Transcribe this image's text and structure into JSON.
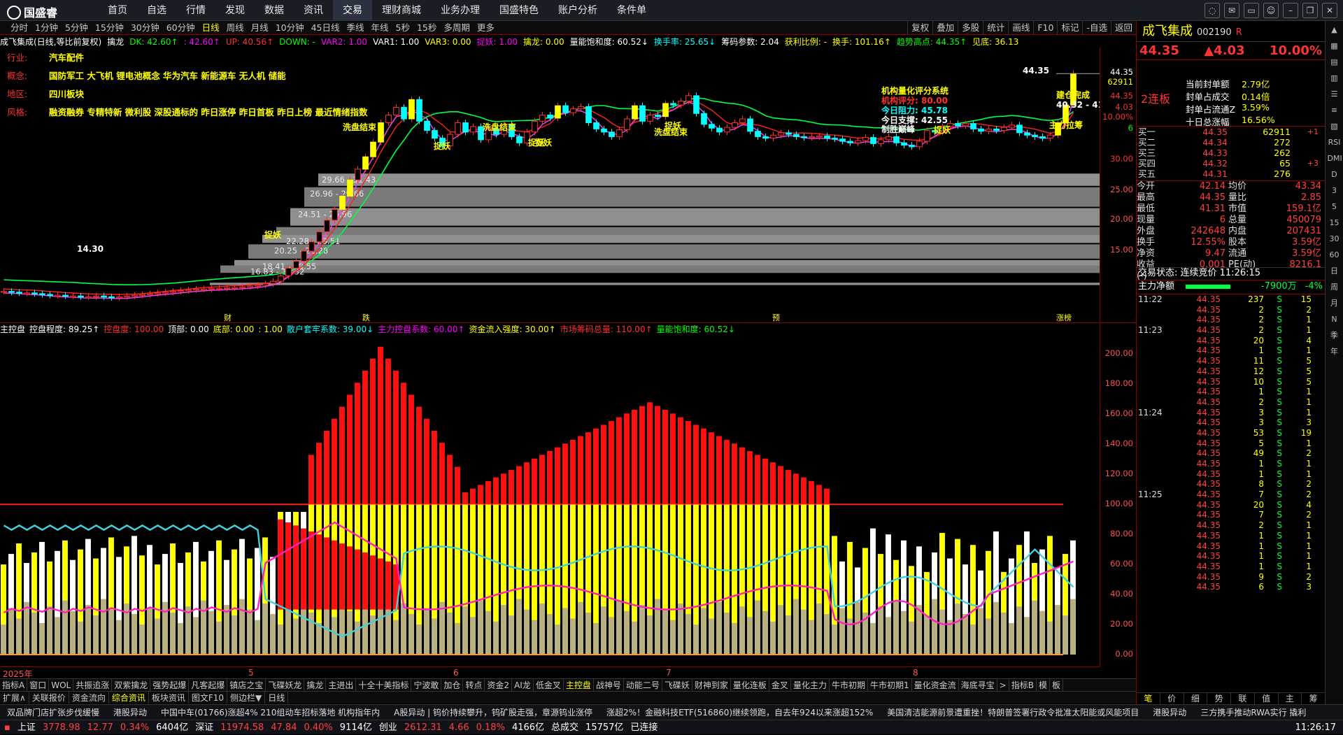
{
  "app": {
    "logo": "国盛睿"
  },
  "menu": [
    "首页",
    "自选",
    "行情",
    "发现",
    "数据",
    "资讯",
    "交易",
    "理财商城",
    "业务办理",
    "国盛特色",
    "账户分析",
    "条件单"
  ],
  "menu_active": 6,
  "window_icons": [
    "chat-icon",
    "mail-icon",
    "screen-icon",
    "user-icon",
    "minimize-icon",
    "restore-icon",
    "close-icon"
  ],
  "period": {
    "items": [
      "分时",
      "1分钟",
      "5分钟",
      "15分钟",
      "30分钟",
      "60分钟",
      "日线",
      "周线",
      "月线",
      "10分钟",
      "45日线",
      "季线",
      "年线",
      "5秒",
      "15秒",
      "多周期",
      "更多"
    ],
    "selected": 6,
    "tools": [
      "复权",
      "叠加",
      "多股",
      "统计",
      "画线",
      "F10",
      "标记",
      "-自选",
      "返回"
    ]
  },
  "quote_header": [
    {
      "t": "成飞集成(日线,等比前复权)",
      "c": "#ffffff"
    },
    {
      "t": "擒龙",
      "c": "#ffffff"
    },
    {
      "t": "DK: 42.60↑",
      "c": "#00ff00"
    },
    {
      "t": ": 42.60↑",
      "c": "#ff00ff"
    },
    {
      "t": "UP: 40.56↑",
      "c": "#ff3030"
    },
    {
      "t": "DOWN: -",
      "c": "#00ff00"
    },
    {
      "t": "VAR2: 1.00",
      "c": "#ff00ff"
    },
    {
      "t": "VAR1: 1.00",
      "c": "#ffffff"
    },
    {
      "t": "VAR3: 0.00",
      "c": "#ffff00"
    },
    {
      "t": "捉妖: 1.00",
      "c": "#ff00ff"
    },
    {
      "t": "擒龙: 0.00",
      "c": "#ffff00"
    },
    {
      "t": "量能饱和度: 60.52↓",
      "c": "#ffffff"
    },
    {
      "t": "换手率: 25.65↓",
      "c": "#00ffff"
    },
    {
      "t": "筹码参数: 2.04",
      "c": "#ffffff"
    },
    {
      "t": "获利比例: -",
      "c": "#ffff00"
    },
    {
      "t": "换手: 101.16↑",
      "c": "#ffff00"
    },
    {
      "t": "趋势高点: 44.35↑",
      "c": "#00ff00"
    },
    {
      "t": "见底: 36.13",
      "c": "#ffff00"
    }
  ],
  "info": [
    {
      "k": "行业:",
      "v": "汽车配件"
    },
    {
      "k": "概念:",
      "v": "国防军工 大飞机 锂电池概念 华为汽车 新能源车 无人机 储能"
    },
    {
      "k": "地区:",
      "v": "四川板块"
    },
    {
      "k": "风格:",
      "v": "融资融券 专精特新 微利股 深股通标的 昨日涨停 昨日首板 昨日上榜 最近情绪指数"
    }
  ],
  "k_annotations": [
    {
      "t": "洗盘结束",
      "c": "#ffff00"
    },
    {
      "t": "洗盘结束",
      "c": "#ffff00"
    },
    {
      "t": "洗盘结束",
      "c": "#ffff00"
    },
    {
      "t": "捉妖",
      "c": "#ffff00"
    },
    {
      "t": "捉妖",
      "c": "#ffff00"
    },
    {
      "t": "捉妖",
      "c": "#ffff00"
    },
    {
      "t": "捉妖",
      "c": "#ffff00"
    },
    {
      "t": "捉妖",
      "c": "#ffff00"
    },
    {
      "t": "机构量化评分系统",
      "c": "#ffff00"
    },
    {
      "t": "机构评分: 80.00",
      "c": "#ff3030"
    },
    {
      "t": "今日阻力: 45.78",
      "c": "#00ffff"
    },
    {
      "t": "今日支撑: 42.55",
      "c": "#ffffff"
    },
    {
      "t": "制胜巅峰",
      "c": "#ffffff"
    },
    {
      "t": "建仓完成",
      "c": "#ffff00"
    },
    {
      "t": "主力拉筹",
      "c": "#ffff00"
    },
    {
      "t": "44.35",
      "c": "#ffffff"
    },
    {
      "t": "14.30",
      "c": "#ffffff"
    },
    {
      "t": "40.32 - 41.3",
      "c": "#ffffff"
    }
  ],
  "chip_labels": [
    "29.66 - 31.43",
    "26.96 - 29.66",
    "24.51 - 26.96",
    "22.28 - 23.51",
    "20.25 - 22.28",
    "18.41 - 19.55",
    "16.83 - 17.32"
  ],
  "chip_tag": "捉妖",
  "price_axis": {
    "labels": [
      "44.35",
      "62911",
      "44.35",
      "4.03",
      "10.00%",
      "6",
      "30.00",
      "25.00",
      "20.00",
      "15.00"
    ]
  },
  "x_bottom_tags": [
    "财",
    "跌",
    "预",
    "涨榜"
  ],
  "ind_header": [
    {
      "t": "主控盘",
      "c": "#ffffff"
    },
    {
      "t": "控盘程度: 89.25↑",
      "c": "#ffffff"
    },
    {
      "t": "控盘度: 100.00",
      "c": "#ff3030"
    },
    {
      "t": "顶部: 0.00",
      "c": "#ffffff"
    },
    {
      "t": "底部: 0.00",
      "c": "#ffff00"
    },
    {
      "t": ": 1.00",
      "c": "#ffff00"
    },
    {
      "t": "散户套牢系数: 39.00↓",
      "c": "#00ffff"
    },
    {
      "t": "主力控盘系数: 60.00↑",
      "c": "#ff00ff"
    },
    {
      "t": "资金流入强度: 30.00↑",
      "c": "#ffff00"
    },
    {
      "t": "市场筹码总量: 110.00↑",
      "c": "#ff3030"
    },
    {
      "t": "量能饱和度: 60.52↓",
      "c": "#00ff00"
    }
  ],
  "ind_axis": [
    "200.00",
    "180.00",
    "160.00",
    "140.00",
    "120.00",
    "100.00",
    "80.00",
    "60.00",
    "40.00",
    "20.00",
    "0.00"
  ],
  "xaxis": [
    "2025年",
    "5",
    "6",
    "7",
    "8"
  ],
  "ind_tabs": [
    "指标A",
    "窗口",
    "WOL",
    "共振追涨",
    "双紫擒龙",
    "强势起爆",
    "凡客起爆",
    "镇店之宝",
    "飞碟妖龙",
    "擒龙",
    "主进出",
    "十全十美指标",
    "宁波敢",
    "加仓",
    "转点",
    "资金2",
    "AI龙",
    "低金叉",
    "主控盘",
    "战神号",
    "动能二号",
    "飞碟妖",
    "财神到家",
    "量化连板",
    "金叉",
    "量化主力",
    "牛市初期",
    "牛市初期1",
    "量化资金流",
    "海底寻宝",
    ">",
    "指标B",
    "模",
    "板"
  ],
  "ind_tabs_sel": 18,
  "sub_tabs": [
    "扩展∧",
    "关联报价",
    "资金流向",
    "综合资讯",
    "板块资讯",
    "图文F10",
    "侧边栏▼",
    "日线"
  ],
  "sub_tabs_sel": 3,
  "news": [
    "双品牌门店扩张步伐缓慢",
    "港股异动",
    "中国中车(01766)涨超4% 210组动车招标落地 机构指年内",
    "A股异动 | 钨价持续攀升，钨矿股走强，章源钨业涨停",
    "涨超2%！金融科技ETF(516860)继续领跑，自去年924以来涨超152%",
    "美国清洁能源前景遭重挫！特朗普签署行政令批准太阳能或风能项目",
    "港股异动",
    "三方携手推动RWA实行 撬利"
  ],
  "status": {
    "sh_name": "上证",
    "sh": "3778.98",
    "sh_ch": "12.77",
    "sh_pct": "0.34%",
    "sh_amt": "6404亿",
    "sz_name": "深证",
    "sz": "11974.58",
    "sz_ch": "47.84",
    "sz_pct": "0.40%",
    "sz_amt": "9114亿",
    "cy_name": "创业",
    "cy": "2612.31",
    "cy_ch": "4.66",
    "cy_pct": "0.18%",
    "cy_amt": "4166亿",
    "total_label": "总成交",
    "total": "15757亿",
    "conn": "已连接",
    "time": "11:26:17"
  },
  "stock": {
    "name": "成飞集成",
    "code": "002190",
    "flag": "R",
    "price": "44.35",
    "change": "▲4.03",
    "pct": "10.00%",
    "lianban": "2连板"
  },
  "limit_stats": [
    {
      "k": "当前封单额",
      "v": "2.79亿"
    },
    {
      "k": "封单占成交",
      "v": "0.14倍"
    },
    {
      "k": "封单占流通Z",
      "v": "3.59%"
    },
    {
      "k": "十日总涨幅",
      "v": "16.56%"
    }
  ],
  "orderbook": [
    {
      "n": "买一",
      "p": "44.35",
      "q": "62911",
      "c": "+1"
    },
    {
      "n": "买二",
      "p": "44.34",
      "q": "272",
      "c": ""
    },
    {
      "n": "买三",
      "p": "44.33",
      "q": "262",
      "c": ""
    },
    {
      "n": "买四",
      "p": "44.32",
      "q": "65",
      "c": "+3"
    },
    {
      "n": "买五",
      "p": "44.31",
      "q": "276",
      "c": ""
    }
  ],
  "quotegrid": [
    {
      "k": "今开",
      "v": "42.14",
      "k2": "均价",
      "v2": "43.34"
    },
    {
      "k": "最高",
      "v": "44.35",
      "k2": "量比",
      "v2": "2.85"
    },
    {
      "k": "最低",
      "v": "41.31",
      "k2": "市值",
      "v2": "159.1亿"
    },
    {
      "k": "现量",
      "v": "6",
      "k2": "总量",
      "v2": "450079"
    },
    {
      "k": "外盘",
      "v": "242648",
      "k2": "内盘",
      "v2": "207431"
    },
    {
      "k": "换手",
      "v": "12.55%",
      "k2": "股本",
      "v2": "3.59亿"
    },
    {
      "k": "净资",
      "v": "9.47",
      "k2": "流通",
      "v2": "3.59亿"
    },
    {
      "k": "收益(-)",
      "v": "0.001",
      "k2": "PE(动)",
      "v2": "8216.1"
    }
  ],
  "trade_status": "交易状态: 连续竞价 11:26:15",
  "netflow": {
    "k": "主力净额",
    "v": "-7900万",
    "pct": "-4%"
  },
  "ticks": [
    {
      "t": "11:22",
      "p": "44.35",
      "q": "237",
      "s": "S",
      "c": "15"
    },
    {
      "t": "",
      "p": "44.35",
      "q": "2",
      "s": "S",
      "c": "2"
    },
    {
      "t": "",
      "p": "44.35",
      "q": "2",
      "s": "S",
      "c": "1"
    },
    {
      "t": "11:23",
      "p": "44.35",
      "q": "2",
      "s": "S",
      "c": "1"
    },
    {
      "t": "",
      "p": "44.35",
      "q": "20",
      "s": "S",
      "c": "4"
    },
    {
      "t": "",
      "p": "44.35",
      "q": "1",
      "s": "S",
      "c": "1"
    },
    {
      "t": "",
      "p": "44.35",
      "q": "11",
      "s": "S",
      "c": "5"
    },
    {
      "t": "",
      "p": "44.35",
      "q": "12",
      "s": "S",
      "c": "5"
    },
    {
      "t": "",
      "p": "44.35",
      "q": "10",
      "s": "S",
      "c": "5"
    },
    {
      "t": "",
      "p": "44.35",
      "q": "1",
      "s": "S",
      "c": "1"
    },
    {
      "t": "",
      "p": "44.35",
      "q": "2",
      "s": "S",
      "c": "1"
    },
    {
      "t": "11:24",
      "p": "44.35",
      "q": "3",
      "s": "S",
      "c": "1"
    },
    {
      "t": "",
      "p": "44.35",
      "q": "3",
      "s": "S",
      "c": "3"
    },
    {
      "t": "",
      "p": "44.35",
      "q": "53",
      "s": "S",
      "c": "19"
    },
    {
      "t": "",
      "p": "44.35",
      "q": "5",
      "s": "S",
      "c": "1"
    },
    {
      "t": "",
      "p": "44.35",
      "q": "49",
      "s": "S",
      "c": "2"
    },
    {
      "t": "",
      "p": "44.35",
      "q": "1",
      "s": "S",
      "c": "1"
    },
    {
      "t": "",
      "p": "44.35",
      "q": "1",
      "s": "S",
      "c": "1"
    },
    {
      "t": "",
      "p": "44.35",
      "q": "8",
      "s": "S",
      "c": "2"
    },
    {
      "t": "11:25",
      "p": "44.35",
      "q": "7",
      "s": "S",
      "c": "2"
    },
    {
      "t": "",
      "p": "44.35",
      "q": "20",
      "s": "S",
      "c": "4"
    },
    {
      "t": "",
      "p": "44.35",
      "q": "7",
      "s": "S",
      "c": "2"
    },
    {
      "t": "",
      "p": "44.35",
      "q": "2",
      "s": "S",
      "c": "1"
    },
    {
      "t": "",
      "p": "44.35",
      "q": "1",
      "s": "S",
      "c": "1"
    },
    {
      "t": "",
      "p": "44.35",
      "q": "1",
      "s": "S",
      "c": "1"
    },
    {
      "t": "",
      "p": "44.35",
      "q": "1",
      "s": "S",
      "c": "1"
    },
    {
      "t": "",
      "p": "44.35",
      "q": "1",
      "s": "S",
      "c": "1"
    },
    {
      "t": "",
      "p": "44.35",
      "q": "9",
      "s": "S",
      "c": "2"
    },
    {
      "t": "",
      "p": "44.35",
      "q": "6",
      "s": "S",
      "c": "3"
    }
  ],
  "rtabs": [
    "笔",
    "价",
    "细",
    "势",
    "联",
    "值",
    "主",
    "筹"
  ],
  "rtabs_sel": 0,
  "side_icons": [
    "arrow-up-icon",
    "grid-icon",
    "grid2-icon",
    "chart-icon",
    "list-icon",
    "list2-icon",
    "chart2-icon",
    "RSI",
    "DMI",
    "D",
    "3",
    "5",
    "15",
    "30",
    "60",
    "日",
    "周",
    "月",
    "N",
    "季",
    "年"
  ],
  "colors": {
    "up": "#ff3030",
    "down": "#00ff00",
    "accent": "#ffff00",
    "frame": "#8b0000"
  },
  "chart_data": [
    {
      "type": "candlestick",
      "title": "成飞集成(日线,等比前复权)",
      "y_axis_labels": [
        "30.00",
        "25.00",
        "20.00",
        "15.00"
      ],
      "ylim": [
        13,
        47
      ],
      "close_path": [
        16.2,
        16.1,
        16.0,
        16.0,
        15.9,
        15.8,
        15.7,
        15.7,
        15.6,
        15.6,
        15.5,
        15.5,
        15.6,
        15.5,
        15.4,
        15.5,
        15.6,
        15.7,
        15.8,
        15.9,
        16.0,
        16.1,
        16.2,
        16.3,
        16.4,
        16.5,
        16.5,
        16.6,
        16.6,
        16.7,
        16.7,
        16.8,
        16.9,
        17.0,
        17.2,
        17.5,
        18.2,
        19.2,
        20.1,
        21.4,
        22.6,
        23.9,
        25.4,
        26.8,
        28.5,
        30.6,
        32.0,
        33.6,
        35.5,
        38.0,
        39.0,
        40.0,
        38.5,
        41.0,
        38.2,
        37.0,
        36.0,
        35.0,
        36.5,
        38.0,
        36.8,
        37.5,
        35.8,
        37.2,
        36.5,
        37.8,
        36.2,
        35.4,
        36.8,
        38.2,
        39.0,
        38.6,
        40.2,
        39.3,
        39.8,
        40.1,
        38.0,
        37.2,
        36.8,
        36.2,
        37.1,
        38.5,
        40.2,
        38.2,
        39.0,
        38.8,
        40.5,
        40.3,
        40.8,
        41.5,
        39.2,
        37.8,
        37.3,
        36.8,
        37.4,
        38.0,
        38.5,
        36.9,
        36.2,
        36.0,
        36.4,
        36.7,
        36.5,
        36.2,
        36.1,
        36.2,
        36.3,
        36.0,
        35.9,
        35.6,
        35.4,
        35.7,
        36.1,
        35.3,
        35.8,
        36.2,
        35.4,
        35.1,
        34.9,
        35.6,
        37.0,
        36.8,
        37.5,
        37.9,
        37.6,
        37.9,
        37.2,
        36.9,
        37.2,
        37.0,
        37.4,
        37.7,
        36.7,
        36.4,
        36.2,
        36.0,
        36.4,
        38.0,
        40.3,
        44.35
      ]
    },
    {
      "type": "bar",
      "title": "主控盘",
      "y_axis_labels": [
        "200.00",
        "180.00",
        "160.00",
        "140.00",
        "120.00",
        "100.00",
        "80.00",
        "60.00",
        "40.00",
        "20.00",
        "0.00"
      ],
      "ylim": [
        0,
        210
      ]
    }
  ]
}
